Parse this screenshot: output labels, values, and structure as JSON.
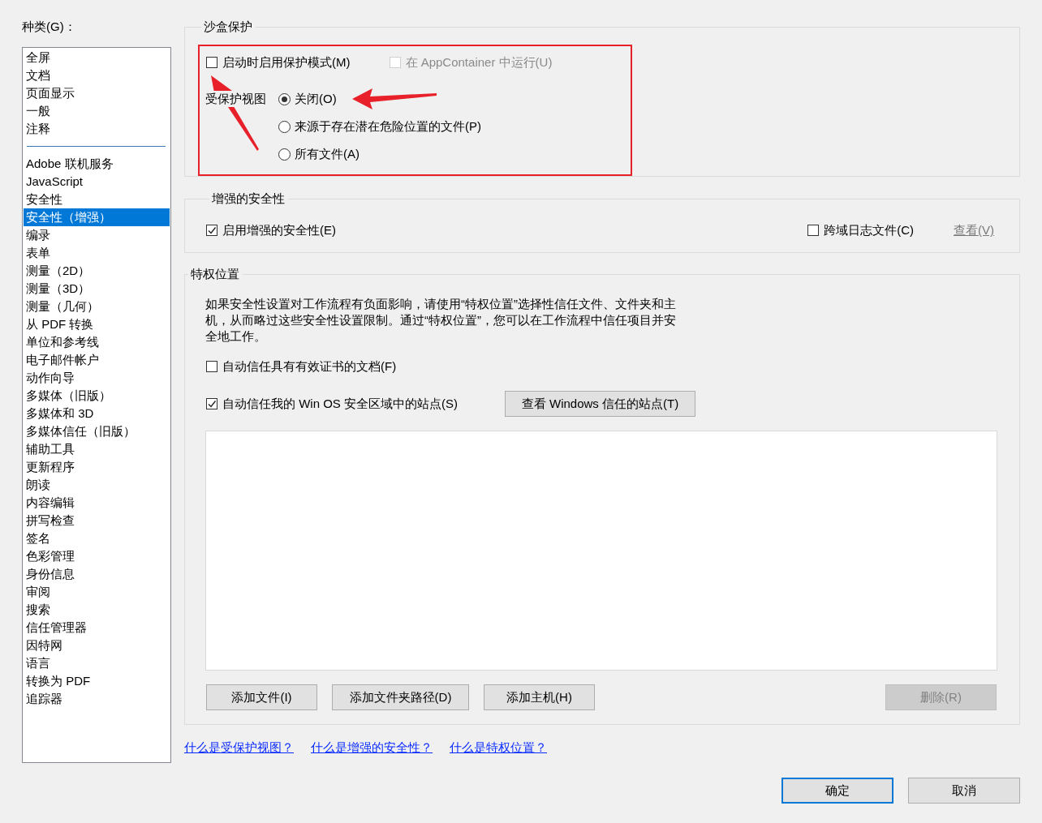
{
  "category": {
    "label": "种类(G)：",
    "groups": [
      {
        "items": [
          {
            "label": "全屏",
            "selected": false
          },
          {
            "label": "文档",
            "selected": false
          },
          {
            "label": "页面显示",
            "selected": false
          },
          {
            "label": "一般",
            "selected": false
          },
          {
            "label": "注释",
            "selected": false
          }
        ]
      },
      {
        "items": [
          {
            "label": "Adobe 联机服务",
            "selected": false
          },
          {
            "label": "JavaScript",
            "selected": false
          },
          {
            "label": "安全性",
            "selected": false
          },
          {
            "label": "安全性（增强）",
            "selected": true
          },
          {
            "label": "编录",
            "selected": false
          },
          {
            "label": "表单",
            "selected": false
          },
          {
            "label": "测量（2D）",
            "selected": false
          },
          {
            "label": "测量（3D）",
            "selected": false
          },
          {
            "label": "测量（几何）",
            "selected": false
          },
          {
            "label": "从 PDF 转换",
            "selected": false
          },
          {
            "label": "单位和参考线",
            "selected": false
          },
          {
            "label": "电子邮件帐户",
            "selected": false
          },
          {
            "label": "动作向导",
            "selected": false
          },
          {
            "label": "多媒体（旧版）",
            "selected": false
          },
          {
            "label": "多媒体和 3D",
            "selected": false
          },
          {
            "label": "多媒体信任（旧版）",
            "selected": false
          },
          {
            "label": "辅助工具",
            "selected": false
          },
          {
            "label": "更新程序",
            "selected": false
          },
          {
            "label": "朗读",
            "selected": false
          },
          {
            "label": "内容编辑",
            "selected": false
          },
          {
            "label": "拼写检查",
            "selected": false
          },
          {
            "label": "签名",
            "selected": false
          },
          {
            "label": "色彩管理",
            "selected": false
          },
          {
            "label": "身份信息",
            "selected": false
          },
          {
            "label": "审阅",
            "selected": false
          },
          {
            "label": "搜索",
            "selected": false
          },
          {
            "label": "信任管理器",
            "selected": false
          },
          {
            "label": "因特网",
            "selected": false
          },
          {
            "label": "语言",
            "selected": false
          },
          {
            "label": "转换为 PDF",
            "selected": false
          },
          {
            "label": "追踪器",
            "selected": false
          }
        ]
      }
    ]
  },
  "sandbox": {
    "title": "沙盒保护",
    "protected_mode": {
      "label": "启动时启用保护模式(M)",
      "checked": false,
      "disabled": false
    },
    "app_container": {
      "label": "在 AppContainer 中运行(U)",
      "checked": false,
      "disabled": true
    },
    "protected_view": {
      "label": "受保护视图",
      "options": [
        {
          "label": "关闭(O)",
          "selected": true
        },
        {
          "label": "来源于存在潜在危险位置的文件(P)",
          "selected": false
        },
        {
          "label": "所有文件(A)",
          "selected": false
        }
      ]
    }
  },
  "enhanced_security": {
    "title": "增强的安全性",
    "enable": {
      "label": "启用增强的安全性(E)",
      "checked": true,
      "disabled": false
    },
    "cross_domain_log": {
      "label": "跨域日志文件(C)",
      "checked": false,
      "disabled": false
    },
    "view_link": {
      "label": "查看(V)",
      "disabled": true
    }
  },
  "privileged_locations": {
    "title": "特权位置",
    "description": "如果安全性设置对工作流程有负面影响，请使用“特权位置”选择性信任文件、文件夹和主机，从而略过这些安全性设置限制。通过“特权位置”，您可以在工作流程中信任项目并安全地工作。",
    "auto_trust_certified": {
      "label": "自动信任具有有效证书的文档(F)",
      "checked": false,
      "disabled": false
    },
    "auto_trust_win_os": {
      "label": "自动信任我的 Win OS 安全区域中的站点(S)",
      "checked": true,
      "disabled": false
    },
    "view_windows_sites_button": {
      "label": "查看 Windows 信任的站点(T)",
      "disabled": false
    },
    "buttons": [
      {
        "label": "添加文件(I)",
        "disabled": false
      },
      {
        "label": "添加文件夹路径(D)",
        "disabled": false
      },
      {
        "label": "添加主机(H)",
        "disabled": false
      },
      {
        "label": "删除(R)",
        "disabled": true
      }
    ]
  },
  "help_links": [
    {
      "label": "什么是受保护视图？"
    },
    {
      "label": "什么是增强的安全性？"
    },
    {
      "label": "什么是特权位置？"
    }
  ],
  "dialog_buttons": [
    {
      "label": "确定",
      "default": true,
      "disabled": false
    },
    {
      "label": "取消",
      "default": false,
      "disabled": false
    }
  ]
}
